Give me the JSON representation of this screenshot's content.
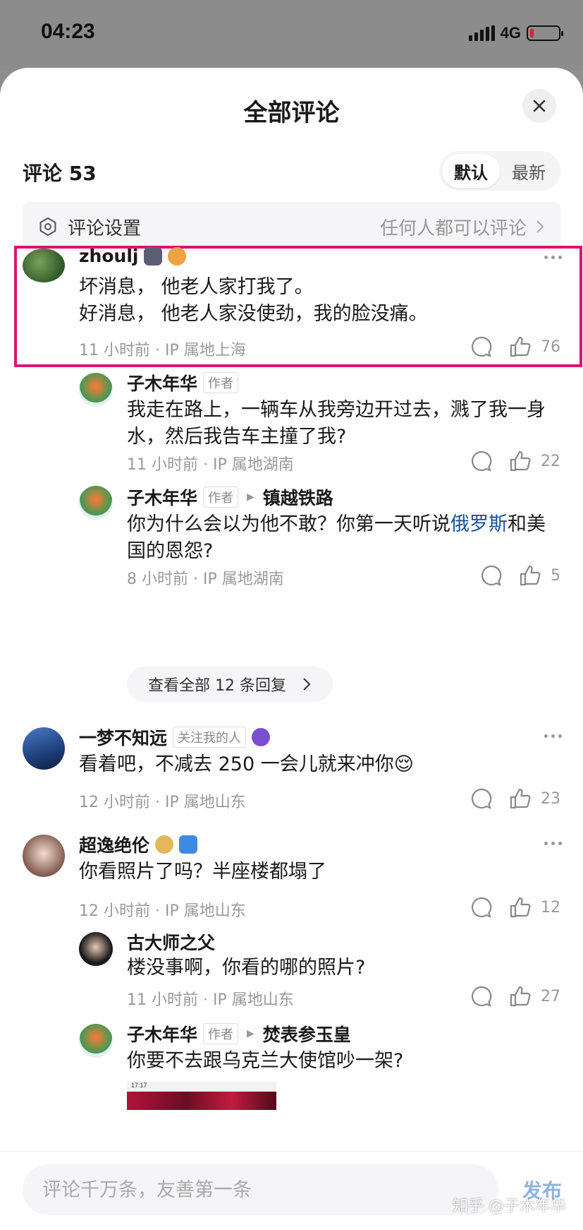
{
  "status_bar": {
    "time": "04:23",
    "network": "4G"
  },
  "sheet": {
    "title": "全部评论"
  },
  "header": {
    "count_label": "评论 53",
    "sort_options": [
      "默认",
      "最新"
    ],
    "sort_selected": "默认"
  },
  "settings": {
    "label": "评论设置",
    "value": "任何人都可以评论"
  },
  "comments": [
    {
      "author": "zhoulj",
      "text_lines": [
        "坏消息， 他老人家打我了。",
        "好消息， 他老人家没使劲，我的脸没痛。"
      ],
      "time": "11 小时前",
      "location": "IP 属地上海",
      "likes": "76"
    },
    {
      "author": "子木年华",
      "tag": "作者",
      "text": "我走在路上，一辆车从我旁边开过去，溅了我一身水，然后我告车主撞了我?",
      "time": "11 小时前",
      "location": "IP 属地湖南",
      "likes": "22"
    },
    {
      "author": "子木年华",
      "tag": "作者",
      "reply_to": "镇越铁路",
      "text_pre": "你为什么会以为他不敢？你第一天听说",
      "text_link": "俄罗斯",
      "text_post": "和美国的恩怨?",
      "time": "8 小时前",
      "location": "IP 属地湖南",
      "likes": "5"
    },
    {
      "author": "一梦不知远",
      "tag": "关注我的人",
      "text": "看着吧，不减去 250 一会儿就来冲你😌",
      "time": "12 小时前",
      "location": "IP 属地山东",
      "likes": "23"
    },
    {
      "author": "超逸绝伦",
      "text": "你看照片了吗？半座楼都塌了",
      "time": "12 小时前",
      "location": "IP 属地山东",
      "likes": "12"
    },
    {
      "author": "古大师之父",
      "text": "楼没事啊，你看的哪的照片?",
      "time": "11 小时前",
      "location": "IP 属地山东",
      "likes": "27"
    },
    {
      "author": "子木年华",
      "tag": "作者",
      "reply_to": "焚表参玉皇",
      "text": "你要不去跟乌克兰大使馆吵一架?",
      "preview_time": "17:17"
    }
  ],
  "view_all_replies": "查看全部 12 条回复",
  "composer": {
    "placeholder": "评论千万条，友善第一条",
    "send_label": "发布"
  },
  "watermark": "知乎 @子木年华",
  "colors": {
    "highlight_border": "#d81673",
    "link": "#175199",
    "send": "#8fb3e3"
  }
}
